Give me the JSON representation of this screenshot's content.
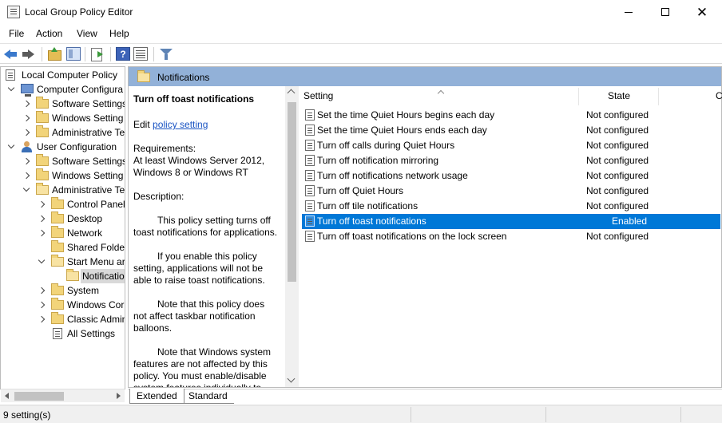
{
  "window": {
    "title": "Local Group Policy Editor"
  },
  "menu": [
    "File",
    "Action",
    "View",
    "Help"
  ],
  "toolbar": {
    "help_label": "?"
  },
  "tree": {
    "root": "Local Computer Policy",
    "computer": "Computer Configura",
    "computer_children": [
      "Software Settings",
      "Windows Setting",
      "Administrative Te"
    ],
    "user": "User Configuration",
    "user_children": [
      "Software Settings",
      "Windows Setting",
      "Administrative Te"
    ],
    "admin_children": [
      "Control Panel",
      "Desktop",
      "Network",
      "Shared Folder",
      "Start Menu ar"
    ],
    "startmenu_child": "Notificatio",
    "admin_rest": [
      "System",
      "Windows Cor",
      "Classic Admin",
      "All Settings"
    ]
  },
  "header": {
    "title": "Notifications"
  },
  "description": {
    "title": "Turn off toast notifications",
    "edit_prefix": "Edit ",
    "edit_link": "policy setting",
    "requirements_label": "Requirements:",
    "requirements_line1": "At least Windows Server 2012,",
    "requirements_line2": "Windows 8 or Windows RT",
    "description_label": "Description:",
    "para1": "This policy setting turns off toast notifications for applications.",
    "para2": "If you enable this policy setting, applications will not be able to raise toast notifications.",
    "para3": "Note that this policy does not affect taskbar notification balloons.",
    "para4": "Note that Windows system features are not affected by this policy.  You must enable/disable system features individually to"
  },
  "list": {
    "col_setting": "Setting",
    "col_state": "State",
    "col_comment": "C",
    "rows": [
      {
        "setting": "Set the time Quiet Hours begins each day",
        "state": "Not configured"
      },
      {
        "setting": "Set the time Quiet Hours ends each day",
        "state": "Not configured"
      },
      {
        "setting": "Turn off calls during Quiet Hours",
        "state": "Not configured"
      },
      {
        "setting": "Turn off notification mirroring",
        "state": "Not configured"
      },
      {
        "setting": "Turn off notifications network usage",
        "state": "Not configured"
      },
      {
        "setting": "Turn off Quiet Hours",
        "state": "Not configured"
      },
      {
        "setting": "Turn off tile notifications",
        "state": "Not configured"
      },
      {
        "setting": "Turn off toast notifications",
        "state": "Enabled"
      },
      {
        "setting": "Turn off toast notifications on the lock screen",
        "state": "Not configured"
      }
    ]
  },
  "tabs": [
    "Extended",
    "Standard"
  ],
  "status": {
    "text": "9 setting(s)"
  },
  "colors": {
    "selection": "#0078d7",
    "header_bar": "#92b1d8",
    "link": "#1a54c3"
  }
}
